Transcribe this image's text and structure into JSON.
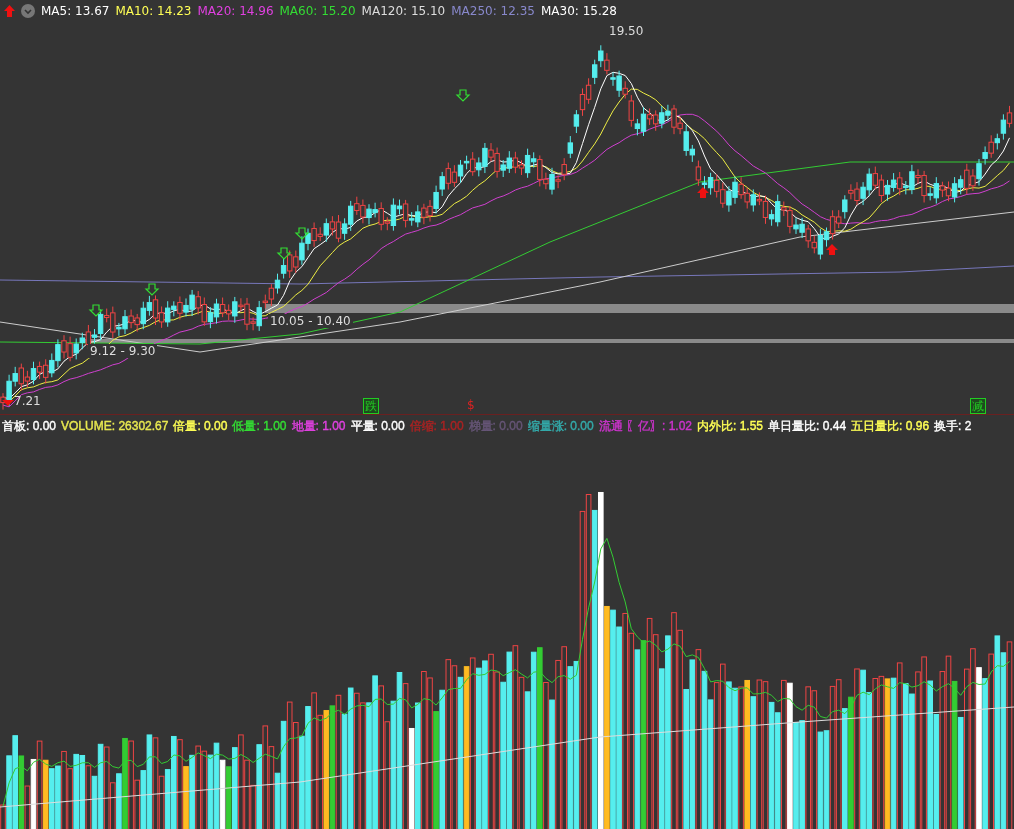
{
  "price_legend": [
    {
      "text": "MA5: 13.67",
      "color": "#ffffff"
    },
    {
      "text": "MA10: 14.23",
      "color": "#ffff55"
    },
    {
      "text": "MA20: 14.96",
      "color": "#e040e0"
    },
    {
      "text": "MA60: 15.20",
      "color": "#33dd33"
    },
    {
      "text": "MA120: 15.10",
      "color": "#dddddd"
    },
    {
      "text": "MA250: 12.35",
      "color": "#8888cc"
    },
    {
      "text": "MA30: 15.28",
      "color": "#ffffff"
    }
  ],
  "price_labels": [
    {
      "text": "19.50",
      "kind": "high"
    },
    {
      "text": "7.21",
      "kind": "low"
    },
    {
      "text": "10.05 - 10.40",
      "kind": "range"
    },
    {
      "text": "9.12 - 9.30",
      "kind": "range"
    }
  ],
  "signal_marks": [
    {
      "text": "跌",
      "color": "#22cc22",
      "kind": "boxed"
    },
    {
      "text": "$",
      "color": "#dd2222",
      "kind": "plain"
    },
    {
      "text": "减",
      "color": "#22cc22",
      "kind": "boxed"
    }
  ],
  "volume_legend": [
    {
      "text": "首板: 0.00",
      "color": "#ffffff"
    },
    {
      "text": "VOLUME: 26302.67",
      "color": "#e8e850"
    },
    {
      "text": "倍量: 0.00",
      "color": "#ffff55"
    },
    {
      "text": "低量: 1.00",
      "color": "#33dd33"
    },
    {
      "text": "地量: 1.00",
      "color": "#e040e0"
    },
    {
      "text": "平量: 0.00",
      "color": "#ffffff"
    },
    {
      "text": "倍缩: 1.00",
      "color": "#aa2222"
    },
    {
      "text": "梯量: 0.00",
      "color": "#665577"
    },
    {
      "text": "缩量涨: 0.00",
      "color": "#33aaaa"
    },
    {
      "text": "流通 〖亿〗: 1.02",
      "color": "#cc33cc"
    },
    {
      "text": "内外比: 1.55",
      "color": "#ffff55"
    },
    {
      "text": "单日量比: 0.44",
      "color": "#ffffff"
    },
    {
      "text": "五日量比: 0.96",
      "color": "#ffff55"
    },
    {
      "text": "换手: 2",
      "color": "#ffffff"
    }
  ]
}
